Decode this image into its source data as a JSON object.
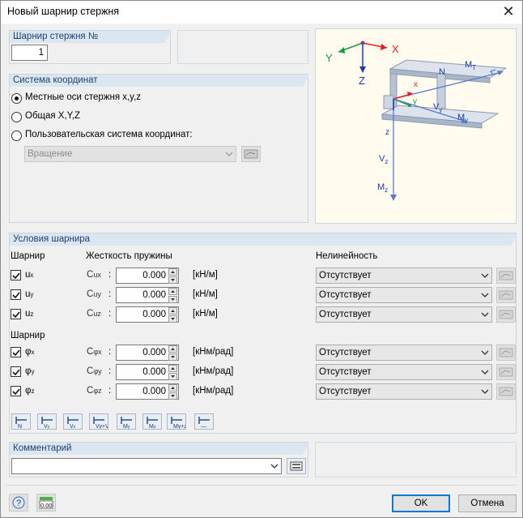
{
  "window": {
    "title": "Новый шарнир стержня"
  },
  "hinge_no": {
    "label": "Шарнир стержня №",
    "value": "1"
  },
  "coord": {
    "label": "Система координат",
    "options": [
      "Местные оси стержня x,y,z",
      "Общая X,Y,Z",
      "Пользовательская система координат:"
    ],
    "selected_index": 0,
    "rotation_value": "Вращение"
  },
  "diagram": {
    "labels": {
      "X": "X",
      "Y": "Y",
      "Z": "Z",
      "N": "N",
      "MT": "M",
      "MT_sub": "T",
      "x": "x",
      "y": "y",
      "z": "z",
      "Vy": "V",
      "Vy_sub": "y",
      "My": "M",
      "My_sub": "y",
      "Vz": "V",
      "Vz_sub": "z",
      "Mz": "M",
      "Mz_sub": "z"
    }
  },
  "conditions": {
    "label": "Условия шарнира",
    "col_hinge": "Шарнир",
    "col_stiffness": "Жесткость пружины",
    "col_nonlinearity": "Нелинейность",
    "translational": [
      {
        "dof": "u",
        "dof_sub": "x",
        "checked": true,
        "spring": "C",
        "spring_sub": "ux",
        "value": "0.000",
        "unit": "[кН/м]",
        "nonlinearity": "Отсутствует"
      },
      {
        "dof": "u",
        "dof_sub": "y",
        "checked": true,
        "spring": "C",
        "spring_sub": "uy",
        "value": "0.000",
        "unit": "[кН/м]",
        "nonlinearity": "Отсутствует"
      },
      {
        "dof": "u",
        "dof_sub": "z",
        "checked": true,
        "spring": "C",
        "spring_sub": "uz",
        "value": "0.000",
        "unit": "[кН/м]",
        "nonlinearity": "Отсутствует"
      }
    ],
    "rotational_label": "Шарнир",
    "rotational": [
      {
        "dof": "φ",
        "dof_sub": "x",
        "checked": true,
        "spring": "C",
        "spring_sub": "φx",
        "value": "0.000",
        "unit": "[кНм/рад]",
        "nonlinearity": "Отсутствует"
      },
      {
        "dof": "φ",
        "dof_sub": "y",
        "checked": true,
        "spring": "C",
        "spring_sub": "φy",
        "value": "0.000",
        "unit": "[кНм/рад]",
        "nonlinearity": "Отсутствует"
      },
      {
        "dof": "φ",
        "dof_sub": "z",
        "checked": true,
        "spring": "C",
        "spring_sub": "φz",
        "value": "0.000",
        "unit": "[кНм/рад]",
        "nonlinearity": "Отсутствует"
      }
    ],
    "presets": [
      {
        "name": "n",
        "main": "N",
        "sub": ""
      },
      {
        "name": "vy",
        "main": "V",
        "sub": "y"
      },
      {
        "name": "vz",
        "main": "V",
        "sub": "z"
      },
      {
        "name": "vyvz",
        "main": "Vy+Vz",
        "sub": ""
      },
      {
        "name": "my",
        "main": "M",
        "sub": "y"
      },
      {
        "name": "mz",
        "main": "M",
        "sub": "z"
      },
      {
        "name": "myz",
        "main": "My+z",
        "sub": ""
      },
      {
        "name": "none",
        "main": "—",
        "sub": ""
      }
    ]
  },
  "comment": {
    "label": "Комментарий",
    "value": ""
  },
  "footer": {
    "ok": "OK",
    "cancel": "Отмена",
    "units_icon_text": "0.00"
  },
  "colors": {
    "panel_head": "#dce6f1",
    "panel_text": "#1e3f73",
    "axis_red": "#e02020",
    "axis_green": "#1a9a3a",
    "axis_blue": "#1a3aa8",
    "force_blue": "#5a7ac8",
    "beam": "#b8c4d6"
  }
}
